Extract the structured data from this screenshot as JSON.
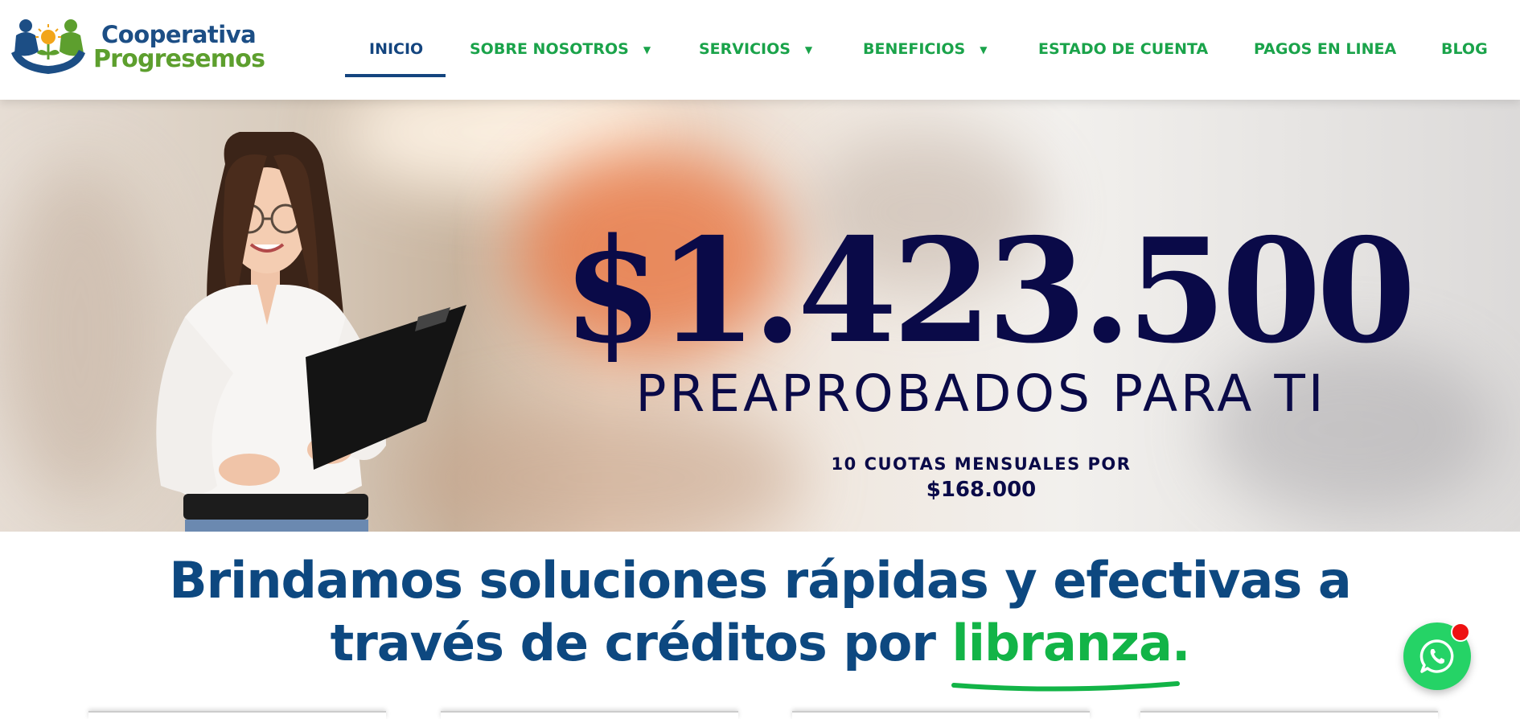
{
  "logo": {
    "line1": "Cooperativa",
    "line2": "Progresemos",
    "icon": "hands-people-flower-logo"
  },
  "nav": {
    "items": [
      {
        "label": "INICIO",
        "active": true
      },
      {
        "label": "SOBRE NOSOTROS",
        "has_dropdown": true
      },
      {
        "label": "SERVICIOS",
        "has_dropdown": true
      },
      {
        "label": "BENEFICIOS",
        "has_dropdown": true
      },
      {
        "label": "ESTADO DE CUENTA"
      },
      {
        "label": "PAGOS EN LINEA"
      },
      {
        "label": "BLOG"
      }
    ]
  },
  "hero": {
    "amount": "$1.423.500",
    "subtitle": "PREAPROBADOS PARA TI",
    "cuotas_text": "10 CUOTAS MENSUALES POR",
    "cuota_value": "$168.000"
  },
  "tagline": {
    "line1": "Brindamos soluciones rápidas y efectivas a",
    "line2_prefix": "través de créditos por ",
    "highlight": "libranza."
  },
  "whatsapp": {
    "icon": "whatsapp-icon",
    "badge": "notification-dot"
  },
  "colors": {
    "brand_blue": "#14457f",
    "brand_green": "#1aa34a",
    "hero_text": "#0a0a48",
    "tagline_blue": "#0d4880",
    "highlight_green": "#12b447",
    "whatsapp_green": "#25d366",
    "badge_red": "#ee1111"
  }
}
